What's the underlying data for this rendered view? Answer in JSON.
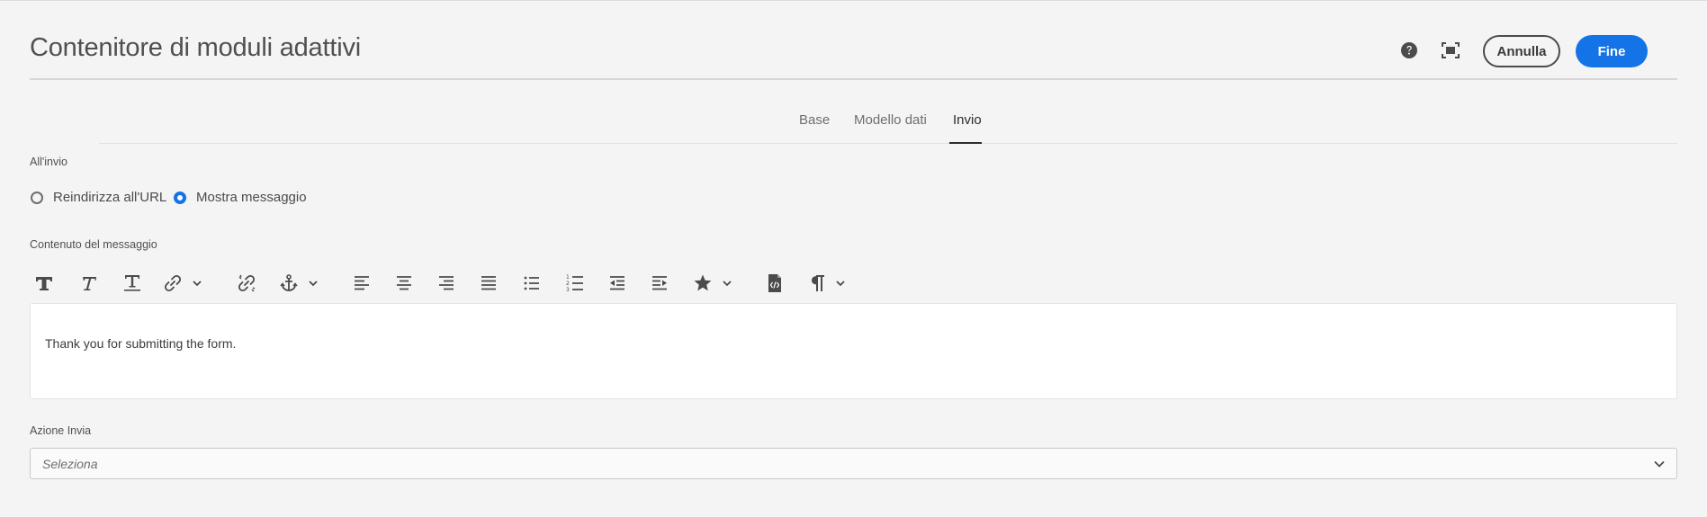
{
  "header": {
    "title": "Contenitore di moduli adattivi",
    "cancel_label": "Annulla",
    "done_label": "Fine",
    "help_icon": "help-circle-icon",
    "fullscreen_icon": "fullscreen-icon"
  },
  "tabs": [
    {
      "label": "Base",
      "active": false
    },
    {
      "label": "Modello dati",
      "active": false
    },
    {
      "label": "Invio",
      "active": true
    }
  ],
  "on_submit": {
    "label": "All'invio",
    "options": [
      {
        "label": "Reindirizza all'URL",
        "selected": false
      },
      {
        "label": "Mostra messaggio",
        "selected": true
      }
    ]
  },
  "message": {
    "label": "Contenuto del messaggio",
    "toolbar": [
      "bold-icon",
      "italic-icon",
      "underline-icon",
      "link-icon",
      "unlink-icon",
      "anchor-icon",
      "align-left-icon",
      "align-center-icon",
      "align-right-icon",
      "justify-icon",
      "bullet-list-icon",
      "numbered-list-icon",
      "outdent-icon",
      "indent-icon",
      "star-icon",
      "source-edit-icon",
      "paragraph-icon"
    ],
    "text": "Thank you for submitting the form."
  },
  "submit_action": {
    "label": "Azione Invia",
    "placeholder": "Seleziona"
  },
  "colors": {
    "accent": "#1473e6",
    "background": "#f4f4f4"
  }
}
